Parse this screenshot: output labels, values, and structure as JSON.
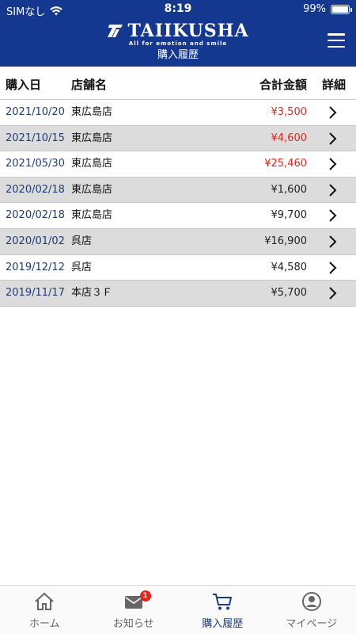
{
  "status_bar": {
    "carrier": "SIMなし",
    "time": "8:19",
    "battery": "99%",
    "battery_level": 0.99
  },
  "header": {
    "logo_text": "TAIIKUSHA",
    "tagline": "All for emotion and smile",
    "page_title": "購入履歴",
    "menu_icon": "hamburger-menu-icon"
  },
  "table": {
    "columns": {
      "date": "購入日",
      "store": "店舗名",
      "amount": "合計金額",
      "detail": "詳細"
    },
    "rows": [
      {
        "date": "2021/10/20",
        "store": "東広島店",
        "amount": "¥3,500",
        "amount_color": "#e3261b"
      },
      {
        "date": "2021/10/15",
        "store": "東広島店",
        "amount": "¥4,600",
        "amount_color": "#e3261b"
      },
      {
        "date": "2021/05/30",
        "store": "東広島店",
        "amount": "¥25,460",
        "amount_color": "#e3261b"
      },
      {
        "date": "2020/02/18",
        "store": "東広島店",
        "amount": "¥1,600",
        "amount_color": "#222222"
      },
      {
        "date": "2020/02/18",
        "store": "東広島店",
        "amount": "¥9,700",
        "amount_color": "#222222"
      },
      {
        "date": "2020/01/02",
        "store": "呉店",
        "amount": "¥16,900",
        "amount_color": "#222222"
      },
      {
        "date": "2019/12/12",
        "store": "呉店",
        "amount": "¥4,580",
        "amount_color": "#222222"
      },
      {
        "date": "2019/11/17",
        "store": "本店３Ｆ",
        "amount": "¥5,700",
        "amount_color": "#222222"
      }
    ]
  },
  "bottom_nav": {
    "items": [
      {
        "label": "ホーム",
        "icon": "home-icon"
      },
      {
        "label": "お知らせ",
        "icon": "mail-icon",
        "badge": "1"
      },
      {
        "label": "購入履歴",
        "icon": "cart-icon"
      },
      {
        "label": "マイページ",
        "icon": "user-icon"
      }
    ]
  },
  "colors": {
    "brand": "#14388f",
    "active_nav": "#1c3e8a",
    "alert": "#e3261b",
    "row_alt": "#dcdcdc"
  }
}
